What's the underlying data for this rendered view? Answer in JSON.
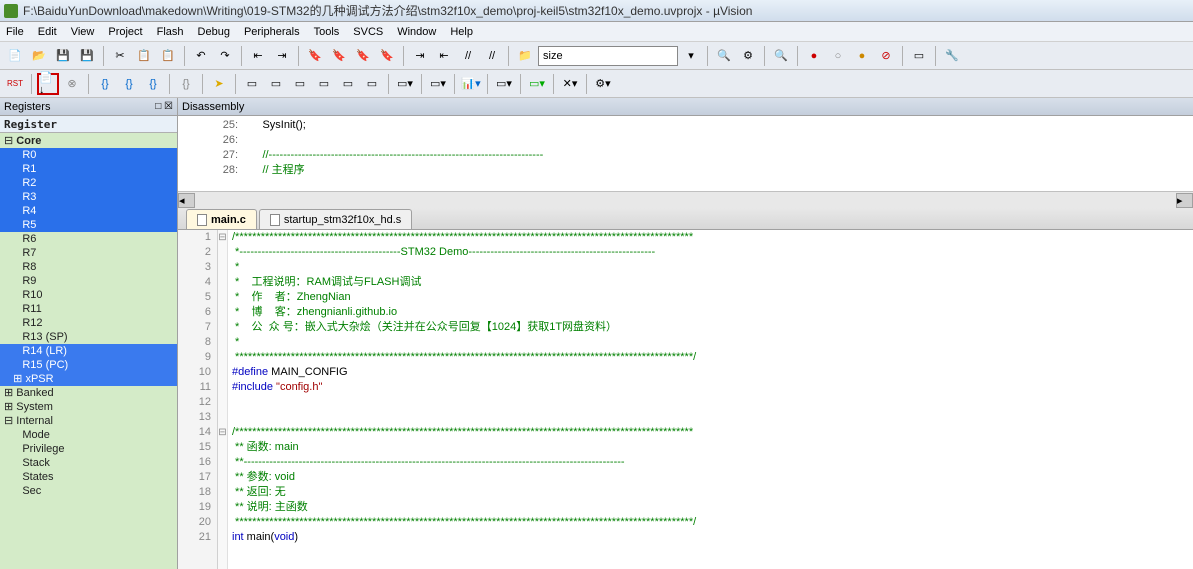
{
  "title": "F:\\BaiduYunDownload\\makedown\\Writing\\019-STM32的几种调试方法介绍\\stm32f10x_demo\\proj-keil5\\stm32f10x_demo.uvprojx - µVision",
  "menu": [
    "File",
    "Edit",
    "View",
    "Project",
    "Flash",
    "Debug",
    "Peripherals",
    "Tools",
    "SVCS",
    "Window",
    "Help"
  ],
  "combo1": "size",
  "panels": {
    "registers": "Registers",
    "register": "Register",
    "disassembly": "Disassembly"
  },
  "regs": {
    "core": "Core",
    "items": [
      "R0",
      "R1",
      "R2",
      "R3",
      "R4",
      "R5",
      "R6",
      "R7",
      "R8",
      "R9",
      "R10",
      "R11",
      "R12",
      "R13 (SP)",
      "R14 (LR)",
      "R15 (PC)",
      "xPSR"
    ],
    "banked": "Banked",
    "system": "System",
    "internal": "Internal",
    "internal_items": [
      "Mode",
      "Privilege",
      "Stack",
      "States",
      "Sec"
    ]
  },
  "disasm": [
    {
      "ln": "25:",
      "txt": "        SysInit();"
    },
    {
      "ln": "26:",
      "txt": ""
    },
    {
      "ln": "27:",
      "txt": "        //---------------------------------------------------------------------------"
    },
    {
      "ln": "28:",
      "txt": "        // 主程序"
    }
  ],
  "tabs": [
    {
      "name": "main.c",
      "active": true
    },
    {
      "name": "startup_stm32f10x_hd.s",
      "active": false
    }
  ],
  "code": [
    {
      "n": 1,
      "f": "⊟",
      "cls": "c-green",
      "txt": "/***********************************************************************************************************"
    },
    {
      "n": 2,
      "f": "",
      "cls": "c-green",
      "txt": " *--------------------------------------------STM32 Demo---------------------------------------------------"
    },
    {
      "n": 3,
      "f": "",
      "cls": "c-green",
      "txt": " *"
    },
    {
      "n": 4,
      "f": "",
      "cls": "c-green",
      "txt": " *    工程说明：RAM调试与FLASH调试"
    },
    {
      "n": 5,
      "f": "",
      "cls": "c-green",
      "txt": " *    作    者：ZhengNian"
    },
    {
      "n": 6,
      "f": "",
      "cls": "c-green",
      "txt": " *    博    客：zhengnianli.github.io"
    },
    {
      "n": 7,
      "f": "",
      "cls": "c-green",
      "txt": " *    公  众 号：嵌入式大杂烩（关注并在公众号回复【1024】获取1T网盘资料）"
    },
    {
      "n": 8,
      "f": "",
      "cls": "c-green",
      "txt": " *"
    },
    {
      "n": 9,
      "f": "",
      "cls": "c-green",
      "txt": " ***********************************************************************************************************/"
    },
    {
      "n": 10,
      "f": "",
      "cls": "",
      "txt": "#define MAIN_CONFIG",
      "kw": true
    },
    {
      "n": 11,
      "f": "",
      "cls": "",
      "txt": "#include \"config.h\"",
      "kw2": true
    },
    {
      "n": 12,
      "f": "",
      "cls": "",
      "txt": ""
    },
    {
      "n": 13,
      "f": "",
      "cls": "",
      "txt": ""
    },
    {
      "n": 14,
      "f": "⊟",
      "cls": "c-green",
      "txt": "/***********************************************************************************************************"
    },
    {
      "n": 15,
      "f": "",
      "cls": "c-green",
      "txt": " ** 函数: main"
    },
    {
      "n": 16,
      "f": "",
      "cls": "c-green",
      "txt": " **-------------------------------------------------------------------------------------------------------- "
    },
    {
      "n": 17,
      "f": "",
      "cls": "c-green",
      "txt": " ** 参数: void"
    },
    {
      "n": 18,
      "f": "",
      "cls": "c-green",
      "txt": " ** 返回: 无"
    },
    {
      "n": 19,
      "f": "",
      "cls": "c-green",
      "txt": " ** 说明: 主函数"
    },
    {
      "n": 20,
      "f": "",
      "cls": "c-green",
      "txt": " ***********************************************************************************************************/"
    },
    {
      "n": 21,
      "f": "",
      "cls": "",
      "txt": "int main(void)",
      "kw3": true
    }
  ]
}
